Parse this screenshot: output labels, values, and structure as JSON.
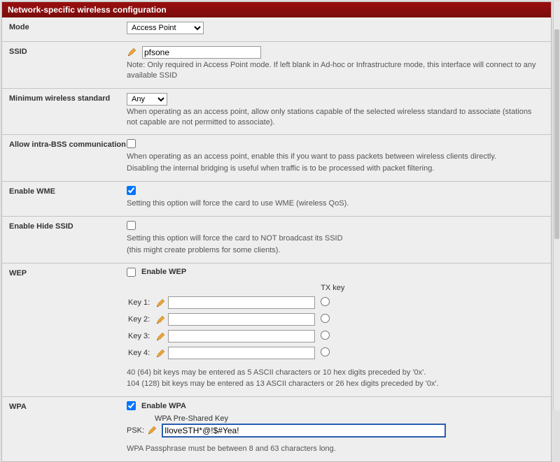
{
  "header": "Network-specific wireless configuration",
  "mode": {
    "label": "Mode",
    "selected": "Access Point"
  },
  "ssid": {
    "label": "SSID",
    "value": "pfsone",
    "note": "Note: Only required in Access Point mode. If left blank in Ad-hoc or Infrastructure mode, this interface will connect to any available SSID"
  },
  "minStd": {
    "label": "Minimum wireless standard",
    "selected": "Any",
    "help": "When operating as an access point, allow only stations capable of the selected wireless standard to associate (stations not capable are not permitted to associate)."
  },
  "intraBss": {
    "label": "Allow intra-BSS communication",
    "help1": "When operating as an access point, enable this if you want to pass packets between wireless clients directly.",
    "help2": "Disabling the internal bridging is useful when traffic is to be processed with packet filtering."
  },
  "wme": {
    "label": "Enable WME",
    "help": "Setting this option will force the card to use WME (wireless QoS)."
  },
  "hideSsid": {
    "label": "Enable Hide SSID",
    "help1": "Setting this option will force the card to NOT broadcast its SSID",
    "help2": "(this might create problems for some clients)."
  },
  "wep": {
    "label": "WEP",
    "enable": "Enable WEP",
    "txkey": "TX key",
    "key1": "Key 1:",
    "key2": "Key 2:",
    "key3": "Key 3:",
    "key4": "Key 4:",
    "help1": "40 (64) bit keys may be entered as 5 ASCII characters or 10 hex digits preceded by '0x'.",
    "help2": "104 (128) bit keys may be entered as 13 ASCII characters or 26 hex digits preceded by '0x'."
  },
  "wpa": {
    "label": "WPA",
    "enable": "Enable WPA",
    "pskSubLabel": "WPA Pre-Shared Key",
    "pskLabel": "PSK:",
    "pskValue": "IloveSTH*@!$#Yea!",
    "help": "WPA Passphrase must be between 8 and 63 characters long."
  }
}
